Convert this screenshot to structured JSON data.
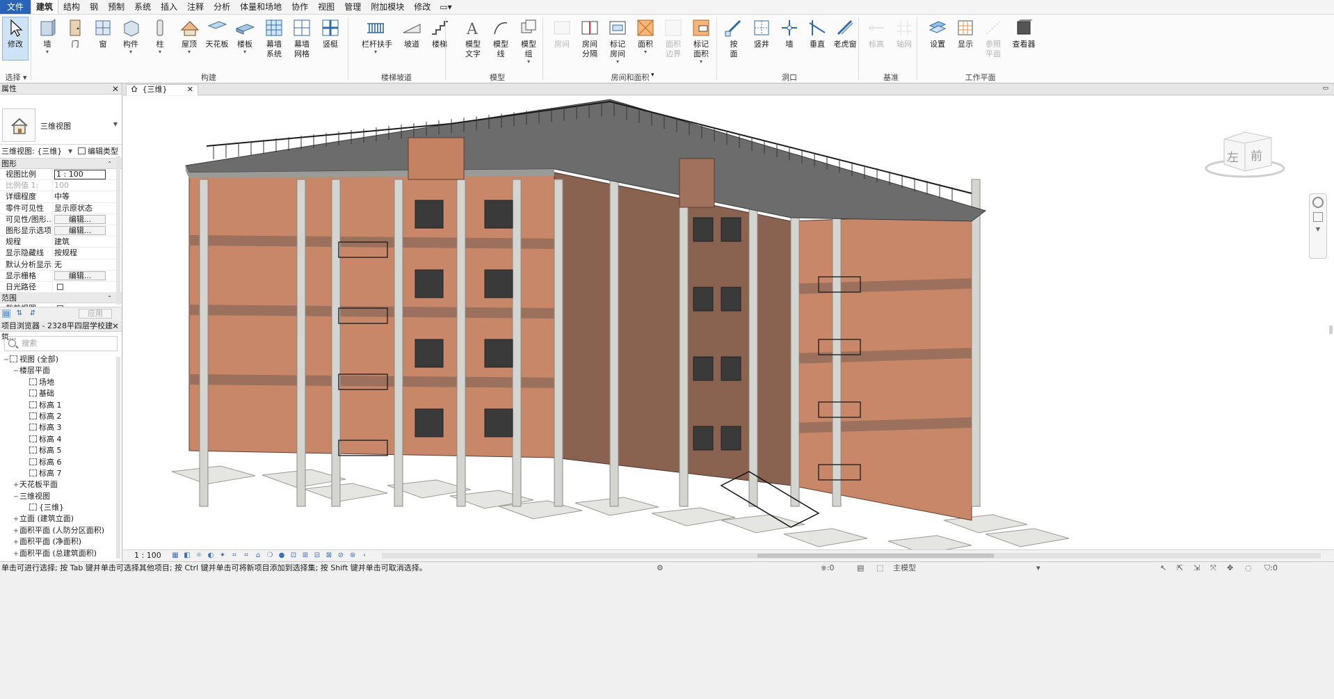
{
  "tabs": [
    "文件",
    "建筑",
    "结构",
    "钢",
    "预制",
    "系统",
    "插入",
    "注释",
    "分析",
    "体量和场地",
    "协作",
    "视图",
    "管理",
    "附加模块",
    "修改"
  ],
  "active_tab": "建筑",
  "ribbon": {
    "modify": "修改",
    "select": "选择",
    "build_buttons": [
      "墙",
      "门",
      "窗",
      "构件",
      "柱",
      "屋顶",
      "天花板",
      "楼板",
      "幕墙\n系统",
      "幕墙\n网格",
      "竖梃"
    ],
    "build_group": "构建",
    "stairs_buttons": [
      "栏杆扶手",
      "坡道",
      "楼梯"
    ],
    "stairs_group": "楼梯坡道",
    "model_buttons": [
      "模型\n文字",
      "模型\n线",
      "模型\n组"
    ],
    "model_group": "模型",
    "room_buttons": [
      "房间",
      "房间\n分隔",
      "标记\n房间",
      "面积",
      "面积\n边界",
      "标记\n面积"
    ],
    "room_group": "房间和面积",
    "opening_buttons": [
      "按\n面",
      "竖井",
      "墙",
      "垂直",
      "老虎窗"
    ],
    "opening_group": "洞口",
    "datum_buttons": [
      "标高",
      "轴网"
    ],
    "datum_group": "基准",
    "workplane_buttons": [
      "设置",
      "显示",
      "参照\n平面",
      "查看器"
    ],
    "workplane_group": "工作平面"
  },
  "properties": {
    "title": "属性",
    "type_name": "三维视图",
    "view_selector": "三维视图: {三维}",
    "edit_type": "编辑类型",
    "cat_graphics": "图形",
    "rows": [
      {
        "k": "视图比例",
        "v": "1 : 100",
        "kind": "input"
      },
      {
        "k": "比例值 1:",
        "v": "100",
        "kind": "gray"
      },
      {
        "k": "详细程度",
        "v": "中等",
        "kind": "text"
      },
      {
        "k": "零件可见性",
        "v": "显示原状态",
        "kind": "text"
      },
      {
        "k": "可见性/图形...",
        "v": "编辑...",
        "kind": "btn"
      },
      {
        "k": "图形显示选项",
        "v": "编辑...",
        "kind": "btn"
      },
      {
        "k": "规程",
        "v": "建筑",
        "kind": "text"
      },
      {
        "k": "显示隐藏线",
        "v": "按规程",
        "kind": "text"
      },
      {
        "k": "默认分析显示...",
        "v": "无",
        "kind": "text"
      },
      {
        "k": "显示栅格",
        "v": "编辑...",
        "kind": "btn"
      },
      {
        "k": "日光路径",
        "v": "",
        "kind": "cb"
      }
    ],
    "cat_extent": "范围",
    "crop_row": "裁剪视图",
    "apply": "应用"
  },
  "browser": {
    "title": "项目浏览器 - 2328平四层学校建筑...",
    "search_placeholder": "搜索",
    "nodes": [
      {
        "t": "视图 (全部)",
        "lvl": 0,
        "tg": "−",
        "icon": true
      },
      {
        "t": "楼层平面",
        "lvl": 1,
        "tg": "−",
        "icon": false
      },
      {
        "t": "场地",
        "lvl": 2,
        "tg": "",
        "icon": true
      },
      {
        "t": "基础",
        "lvl": 2,
        "tg": "",
        "icon": true
      },
      {
        "t": "标高 1",
        "lvl": 2,
        "tg": "",
        "icon": true
      },
      {
        "t": "标高 2",
        "lvl": 2,
        "tg": "",
        "icon": true
      },
      {
        "t": "标高 3",
        "lvl": 2,
        "tg": "",
        "icon": true
      },
      {
        "t": "标高 4",
        "lvl": 2,
        "tg": "",
        "icon": true
      },
      {
        "t": "标高 5",
        "lvl": 2,
        "tg": "",
        "icon": true
      },
      {
        "t": "标高 6",
        "lvl": 2,
        "tg": "",
        "icon": true
      },
      {
        "t": "标高 7",
        "lvl": 2,
        "tg": "",
        "icon": true
      },
      {
        "t": "天花板平面",
        "lvl": 1,
        "tg": "+",
        "icon": false
      },
      {
        "t": "三维视图",
        "lvl": 1,
        "tg": "−",
        "icon": false
      },
      {
        "t": "{三维}",
        "lvl": 2,
        "tg": "",
        "icon": true
      },
      {
        "t": "立面 (建筑立面)",
        "lvl": 1,
        "tg": "+",
        "icon": false
      },
      {
        "t": "面积平面 (人防分区面积)",
        "lvl": 1,
        "tg": "+",
        "icon": false
      },
      {
        "t": "面积平面 (净面积)",
        "lvl": 1,
        "tg": "+",
        "icon": false
      },
      {
        "t": "面积平面 (总建筑面积)",
        "lvl": 1,
        "tg": "+",
        "icon": false
      }
    ]
  },
  "view_tab": "{三维}",
  "view_scale": "1 : 100",
  "status": {
    "message": "单击可进行选择; 按 Tab 键并单击可选择其他项目; 按 Ctrl 键并单击可将新项目添加到选择集; 按 Shift 键并单击可取消选择。",
    "coord": ":0",
    "model": "主模型",
    "filter": ":0"
  },
  "navcube": {
    "left": "左",
    "front": "前"
  },
  "colors": {
    "accent": "#2a64b8",
    "wall": "#c9876a",
    "slab": "#6c6c6c",
    "column": "#d4d4d0"
  }
}
